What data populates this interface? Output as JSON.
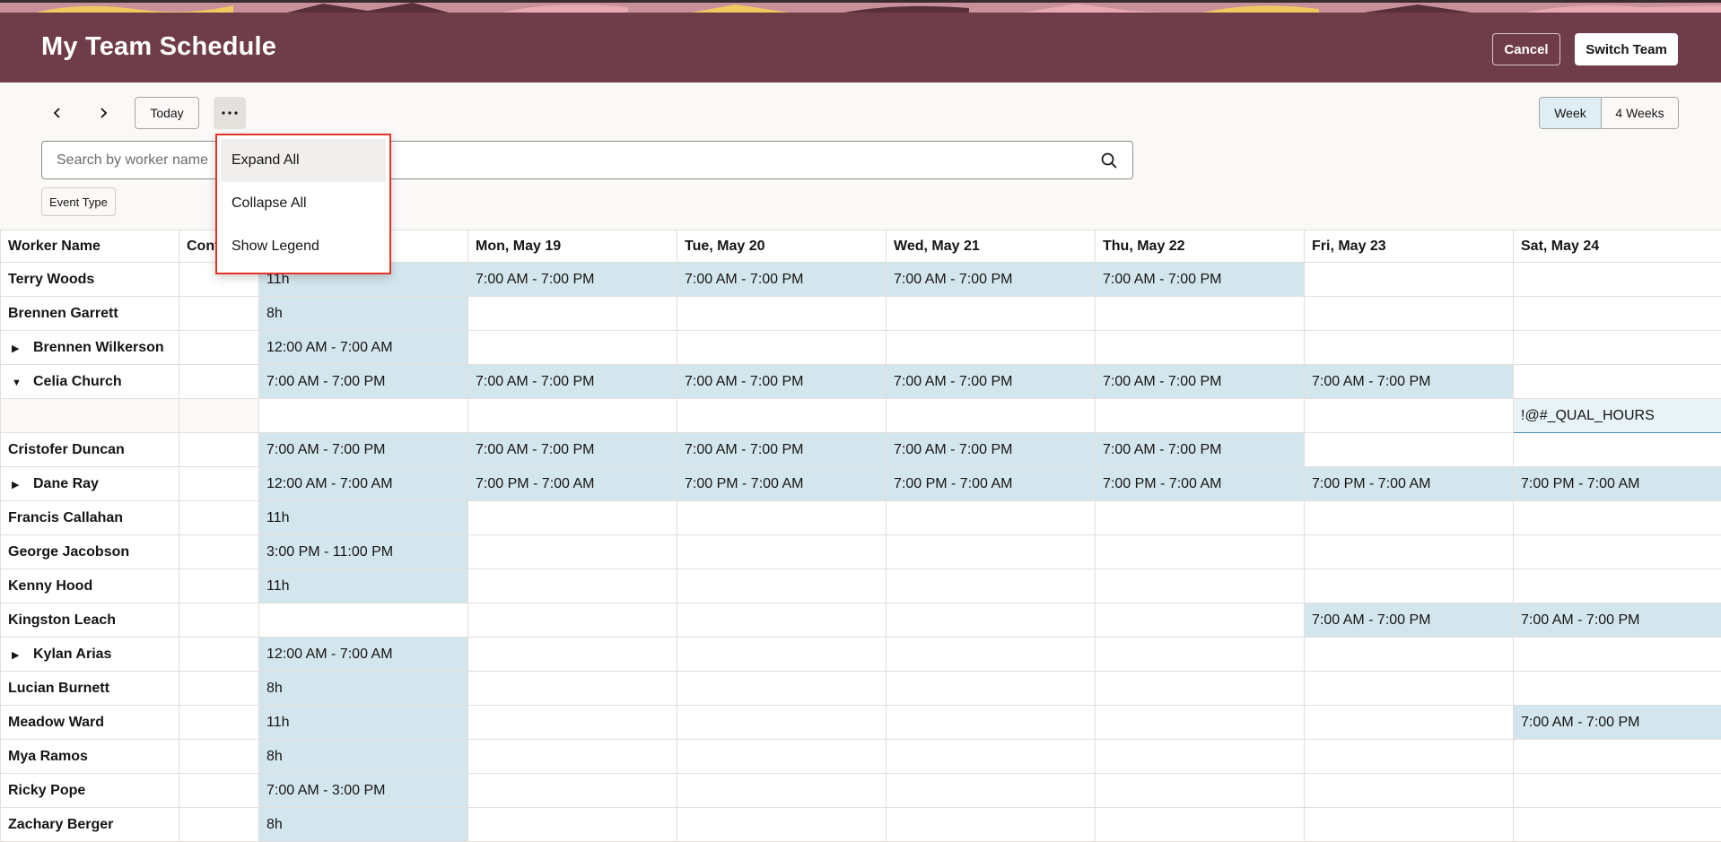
{
  "header": {
    "title": "My Team Schedule",
    "cancel_label": "Cancel",
    "switch_team_label": "Switch Team",
    "background_color": "#6f3c49"
  },
  "toolbar": {
    "prev_icon": "chevron-left-icon",
    "next_icon": "chevron-right-icon",
    "today_label": "Today",
    "more_icon": "more-horizontal-icon",
    "views": [
      "Week",
      "4 Weeks"
    ],
    "selected_view": "Week"
  },
  "search": {
    "placeholder": "Search by worker name",
    "icon": "search-icon"
  },
  "filter_chip": {
    "label": "Event Type"
  },
  "menu": {
    "items": [
      "Expand All",
      "Collapse All",
      "Show Legend"
    ],
    "highlight_color": "#e33327"
  },
  "grid": {
    "columns": [
      "Worker Name",
      "Cont",
      "",
      "Mon, May 19",
      "Tue, May 20",
      "Wed, May 21",
      "Thu, May 22",
      "Fri, May 23",
      "Sat, May 24"
    ],
    "rows": [
      {
        "name": "Terry Woods",
        "expander": "",
        "cells": [
          "11h",
          "7:00 AM - 7:00 PM",
          "7:00 AM - 7:00 PM",
          "7:00 AM - 7:00 PM",
          "7:00 AM - 7:00 PM",
          "",
          ""
        ]
      },
      {
        "name": "Brennen Garrett",
        "expander": "",
        "cells": [
          "8h",
          "",
          "",
          "",
          "",
          "",
          ""
        ]
      },
      {
        "name": "Brennen Wilkerson",
        "expander": "collapsed",
        "cells": [
          "12:00 AM - 7:00 AM",
          "",
          "",
          "",
          "",
          "",
          ""
        ]
      },
      {
        "name": "Celia Church",
        "expander": "expanded",
        "cells": [
          "7:00 AM - 7:00 PM",
          "7:00 AM - 7:00 PM",
          "7:00 AM - 7:00 PM",
          "7:00 AM - 7:00 PM",
          "7:00 AM - 7:00 PM",
          "7:00 AM - 7:00 PM",
          ""
        ]
      },
      {
        "name": "",
        "expander": "detail",
        "cells": [
          "",
          "",
          "",
          "",
          "",
          "",
          "!@#_QUAL_HOURS"
        ]
      },
      {
        "name": "Cristofer Duncan",
        "expander": "",
        "cells": [
          "7:00 AM - 7:00 PM",
          "7:00 AM - 7:00 PM",
          "7:00 AM - 7:00 PM",
          "7:00 AM - 7:00 PM",
          "7:00 AM - 7:00 PM",
          "",
          ""
        ]
      },
      {
        "name": "Dane Ray",
        "expander": "collapsed",
        "cells": [
          "12:00 AM - 7:00 AM",
          "7:00 PM - 7:00 AM",
          "7:00 PM - 7:00 AM",
          "7:00 PM - 7:00 AM",
          "7:00 PM - 7:00 AM",
          "7:00 PM - 7:00 AM",
          "7:00 PM - 7:00 AM"
        ]
      },
      {
        "name": "Francis Callahan",
        "expander": "",
        "cells": [
          "11h",
          "",
          "",
          "",
          "",
          "",
          ""
        ]
      },
      {
        "name": "George Jacobson",
        "expander": "",
        "cells": [
          "3:00 PM - 11:00 PM",
          "",
          "",
          "",
          "",
          "",
          ""
        ]
      },
      {
        "name": "Kenny Hood",
        "expander": "",
        "cells": [
          "11h",
          "",
          "",
          "",
          "",
          "",
          ""
        ]
      },
      {
        "name": "Kingston Leach",
        "expander": "",
        "cells": [
          "",
          "",
          "",
          "",
          "",
          "7:00 AM - 7:00 PM",
          "7:00 AM - 7:00 PM"
        ]
      },
      {
        "name": "Kylan Arias",
        "expander": "collapsed",
        "cells": [
          "12:00 AM - 7:00 AM",
          "",
          "",
          "",
          "",
          "",
          ""
        ]
      },
      {
        "name": "Lucian Burnett",
        "expander": "",
        "cells": [
          "8h",
          "",
          "",
          "",
          "",
          "",
          ""
        ]
      },
      {
        "name": "Meadow Ward",
        "expander": "",
        "cells": [
          "11h",
          "",
          "",
          "",
          "",
          "",
          "7:00 AM - 7:00 PM"
        ]
      },
      {
        "name": "Mya Ramos",
        "expander": "",
        "cells": [
          "8h",
          "",
          "",
          "",
          "",
          "",
          ""
        ]
      },
      {
        "name": "Ricky Pope",
        "expander": "",
        "cells": [
          "7:00 AM - 3:00 PM",
          "",
          "",
          "",
          "",
          "",
          ""
        ]
      },
      {
        "name": "Zachary Berger",
        "expander": "",
        "cells": [
          "8h",
          "",
          "",
          "",
          "",
          "",
          ""
        ]
      }
    ],
    "shift_color": "#d3e6ee"
  }
}
